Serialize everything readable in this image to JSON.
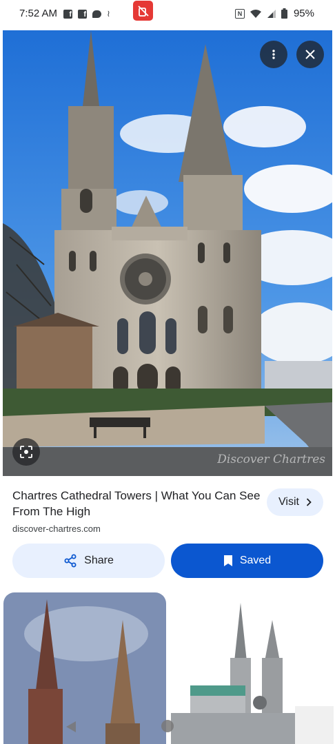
{
  "status_bar": {
    "time": "7:52 AM",
    "battery": "95%",
    "icons": [
      "facebook-icon",
      "facebook-icon",
      "chat-bubble-icon",
      "swirl-icon",
      "do-not-disturb-icon",
      "nfc-icon",
      "wifi-icon",
      "signal-icon",
      "battery-icon"
    ]
  },
  "image_viewer": {
    "watermark": "Discover Chartres",
    "more_icon": "more-vert-icon",
    "close_icon": "close-icon",
    "lens_icon": "lens-icon"
  },
  "result": {
    "title": "Chartres Cathedral Towers | What You Can See From The High",
    "domain": "discover-chartres.com",
    "visit_label": "Visit"
  },
  "actions": {
    "share_label": "Share",
    "saved_label": "Saved"
  },
  "colors": {
    "accent": "#0b57d0",
    "tonal": "#e8f0fe",
    "dnd_badge": "#e53935"
  }
}
